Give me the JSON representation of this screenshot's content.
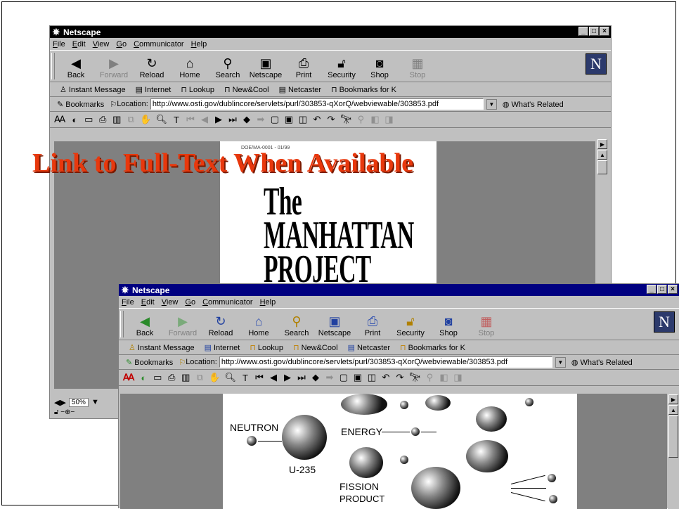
{
  "heading": "Link to Full-Text When Available",
  "window_title": "Netscape",
  "menu": [
    "File",
    "Edit",
    "View",
    "Go",
    "Communicator",
    "Help"
  ],
  "nav_buttons": [
    {
      "label": "Back",
      "icon": "back-arrow-icon",
      "disabled": false
    },
    {
      "label": "Forward",
      "icon": "forward-arrow-icon",
      "disabled": true
    },
    {
      "label": "Reload",
      "icon": "reload-icon",
      "disabled": false
    },
    {
      "label": "Home",
      "icon": "home-icon",
      "disabled": false
    },
    {
      "label": "Search",
      "icon": "search-icon",
      "disabled": false
    },
    {
      "label": "Netscape",
      "icon": "my-netscape-icon",
      "disabled": false
    },
    {
      "label": "Print",
      "icon": "print-icon",
      "disabled": false
    },
    {
      "label": "Security",
      "icon": "lock-icon",
      "disabled": false
    },
    {
      "label": "Shop",
      "icon": "shop-icon",
      "disabled": false
    },
    {
      "label": "Stop",
      "icon": "stop-icon",
      "disabled": true
    }
  ],
  "personal_toolbar": [
    "Instant Message",
    "Internet",
    "Lookup",
    "New&Cool",
    "Netcaster",
    "Bookmarks for K"
  ],
  "bookmarks_label": "Bookmarks",
  "location_label": "Location:",
  "url": "http://www.osti.gov/dublincore/servlets/purl/303853-qXorQ/webviewable/303853.pdf",
  "whats_related": "What's Related",
  "zoom": "50%",
  "doc1": {
    "stamp": "DOE/MA-0001 - 01/99",
    "title_lines": [
      "The",
      "MANHATTAN",
      "PROJECT"
    ]
  },
  "doc2": {
    "labels": {
      "neutron": "NEUTRON",
      "energy": "ENERGY",
      "u235": "U-235",
      "fission": "FISSION",
      "product": "PRODUCT"
    }
  },
  "colors": {
    "heading": "#e8380d",
    "titlebar_active": "#000080",
    "titlebar_back": "#000000"
  }
}
